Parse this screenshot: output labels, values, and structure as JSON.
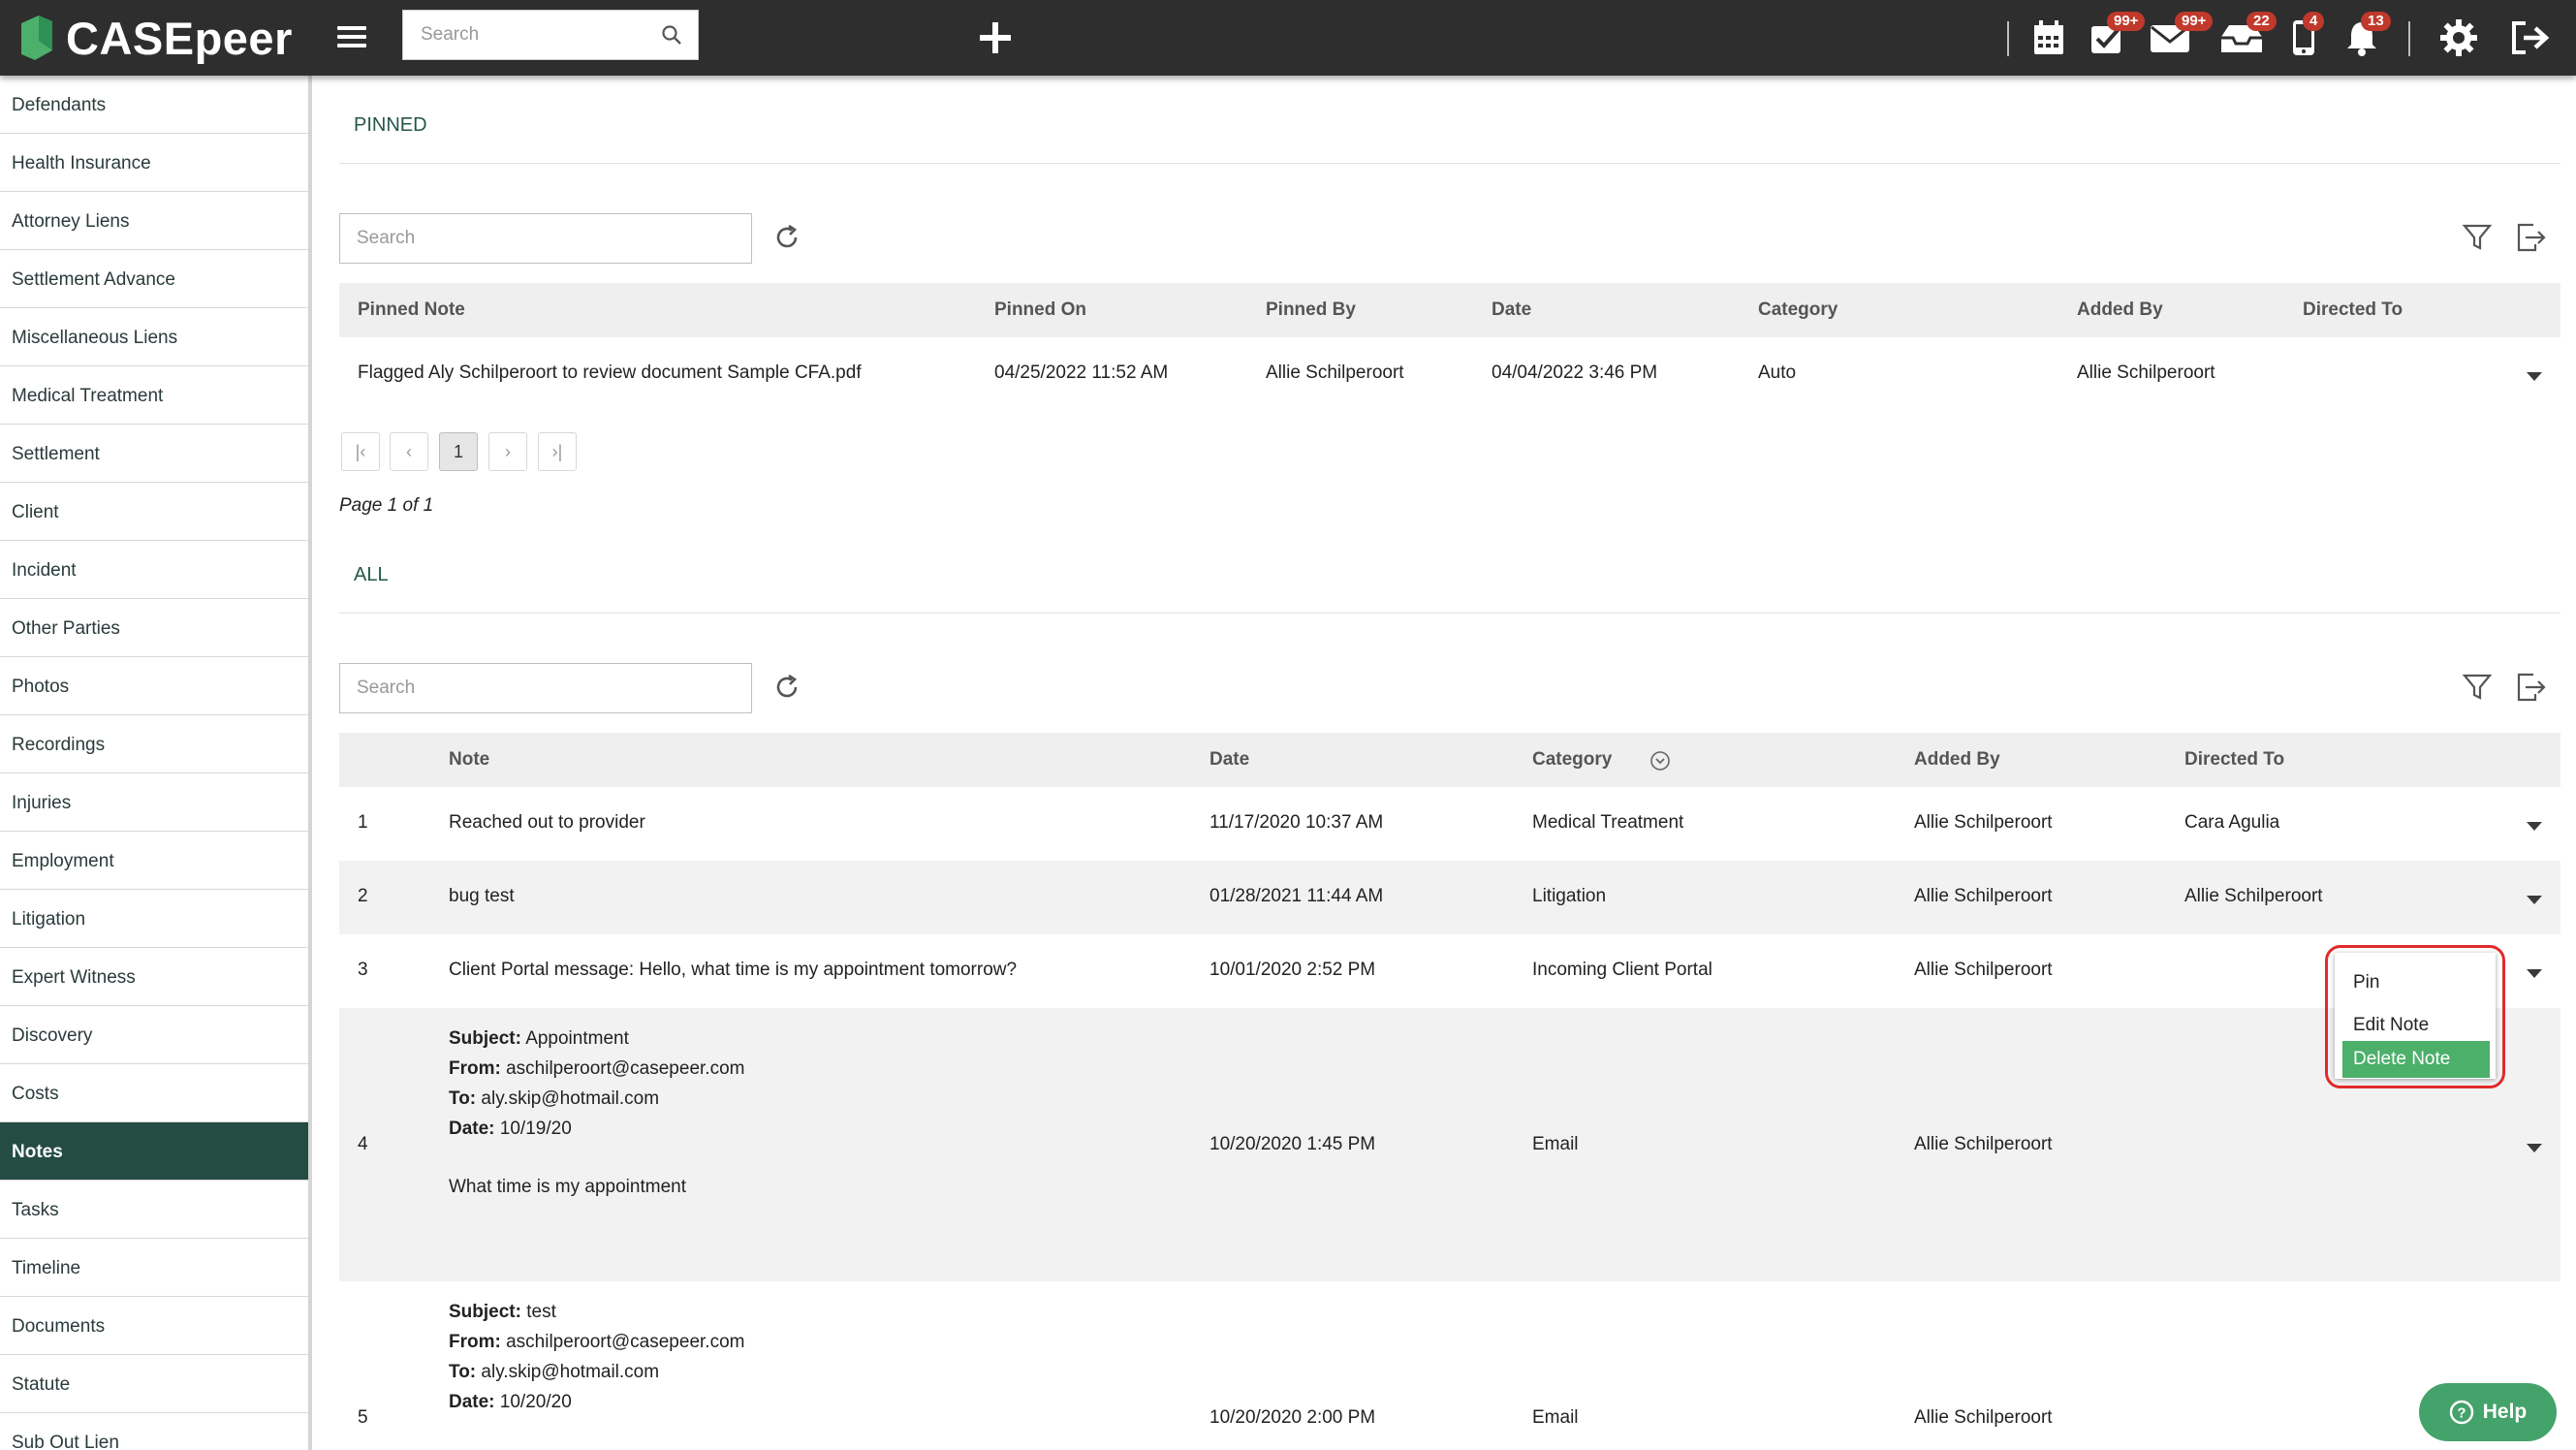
{
  "app": {
    "name": "CASEpeer"
  },
  "topbar": {
    "search_placeholder": "Search",
    "badges": {
      "tasks": "99+",
      "mail": "99+",
      "inbox": "22",
      "phone": "4",
      "notifications": "13"
    }
  },
  "sidebar": {
    "items": [
      {
        "label": "Defendants"
      },
      {
        "label": "Health Insurance"
      },
      {
        "label": "Attorney Liens"
      },
      {
        "label": "Settlement Advance"
      },
      {
        "label": "Miscellaneous Liens"
      },
      {
        "label": "Medical Treatment"
      },
      {
        "label": "Settlement"
      },
      {
        "label": "Client"
      },
      {
        "label": "Incident"
      },
      {
        "label": "Other Parties"
      },
      {
        "label": "Photos"
      },
      {
        "label": "Recordings"
      },
      {
        "label": "Injuries"
      },
      {
        "label": "Employment"
      },
      {
        "label": "Litigation"
      },
      {
        "label": "Expert Witness"
      },
      {
        "label": "Discovery"
      },
      {
        "label": "Costs"
      },
      {
        "label": "Notes",
        "active": true
      },
      {
        "label": "Tasks"
      },
      {
        "label": "Timeline"
      },
      {
        "label": "Documents"
      },
      {
        "label": "Statute"
      },
      {
        "label": "Sub Out Lien"
      }
    ]
  },
  "pinned": {
    "section_label": "PINNED",
    "search_placeholder": "Search",
    "columns": {
      "note": "Pinned Note",
      "pinned_on": "Pinned On",
      "pinned_by": "Pinned By",
      "date": "Date",
      "category": "Category",
      "added_by": "Added By",
      "directed_to": "Directed To"
    },
    "rows": [
      {
        "note": "Flagged Aly Schilperoort to review document Sample CFA.pdf",
        "pinned_on": "04/25/2022 11:52 AM",
        "pinned_by": "Allie Schilperoort",
        "date": "04/04/2022 3:46 PM",
        "category": "Auto",
        "added_by": "Allie Schilperoort",
        "directed_to": ""
      }
    ],
    "pager": {
      "current": "1",
      "summary": "Page 1 of 1"
    }
  },
  "all": {
    "section_label": "ALL",
    "search_placeholder": "Search",
    "columns": {
      "note": "Note",
      "date": "Date",
      "category": "Category",
      "added_by": "Added By",
      "directed_to": "Directed To"
    },
    "rows": [
      {
        "num": "1",
        "note": "Reached out to provider",
        "date": "11/17/2020 10:37 AM",
        "category": "Medical Treatment",
        "added_by": "Allie Schilperoort",
        "directed_to": "Cara Agulia"
      },
      {
        "num": "2",
        "note": "bug test",
        "date": "01/28/2021 11:44 AM",
        "category": "Litigation",
        "added_by": "Allie Schilperoort",
        "directed_to": "Allie Schilperoort"
      },
      {
        "num": "3",
        "note": "Client Portal message: Hello, what time is my appointment tomorrow?",
        "date": "10/01/2020 2:52 PM",
        "category": "Incoming Client Portal",
        "added_by": "Allie Schilperoort",
        "directed_to": ""
      },
      {
        "num": "4",
        "subject_label": "Subject:",
        "subject": "Appointment",
        "from_label": "From:",
        "from": "aschilperoort@casepeer.com",
        "to_label": "To:",
        "to": "aly.skip@hotmail.com",
        "date_label": "Date:",
        "email_date": "10/19/20",
        "body": "What time is my appointment",
        "date": "10/20/2020 1:45 PM",
        "category": "Email",
        "added_by": "Allie Schilperoort",
        "directed_to": ""
      },
      {
        "num": "5",
        "subject_label": "Subject:",
        "subject": "test",
        "from_label": "From:",
        "from": "aschilperoort@casepeer.com",
        "to_label": "To:",
        "to": "aly.skip@hotmail.com",
        "date_label": "Date:",
        "email_date": "10/20/20",
        "body": "",
        "date": "10/20/2020 2:00 PM",
        "category": "Email",
        "added_by": "Allie Schilperoort",
        "directed_to": ""
      }
    ]
  },
  "context_menu": {
    "items": [
      {
        "label": "Pin"
      },
      {
        "label": "Edit Note"
      },
      {
        "label": "Delete Note",
        "highlighted": true
      }
    ]
  },
  "help": {
    "label": "Help"
  },
  "colors": {
    "topbar": "#2e2e2e",
    "active_sidebar": "#244c42",
    "accent_green": "#4caf6a",
    "badge_red": "#c0392b",
    "highlight_outline": "#e02b2b"
  }
}
